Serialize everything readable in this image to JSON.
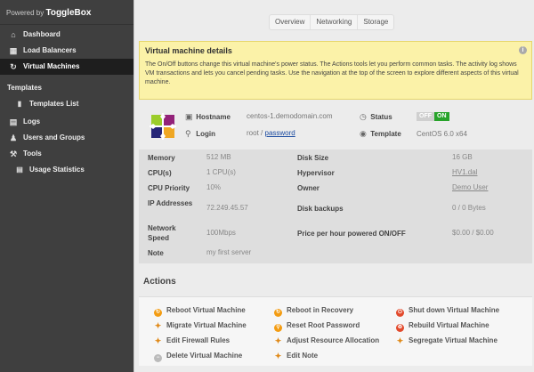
{
  "brand": {
    "prefix": "Powered by ",
    "name": "ToggleBox"
  },
  "sidebar": {
    "items": [
      {
        "label": "Dashboard",
        "icon": "home-icon"
      },
      {
        "label": "Load Balancers",
        "icon": "load-balancer-icon"
      },
      {
        "label": "Virtual Machines",
        "icon": "virtual-machines-icon",
        "active": true
      }
    ],
    "templates_section": "Templates",
    "templates_list": "Templates List",
    "logs": "Logs",
    "users": "Users and Groups",
    "tools": "Tools",
    "usage": "Usage Statistics"
  },
  "tabs": [
    "Overview",
    "Networking",
    "Storage"
  ],
  "notice": {
    "title": "Virtual machine details",
    "text": "The On/Off buttons change this virtual machine's power status. The Actions tools let you perform common tasks. The activity log shows VM transactions and lets you cancel pending tasks. Use the navigation at the top of the screen to explore different aspects of this virtual machine."
  },
  "vm": {
    "hostname_label": "Hostname",
    "hostname": "centos-1.demodomain.com",
    "login_label": "Login",
    "login_user": "root",
    "login_sep": "/",
    "password_link": "password",
    "status_label": "Status",
    "status_off": "OFF",
    "status_on": "ON",
    "template_label": "Template",
    "template": "CentOS 6.0 x64"
  },
  "details": {
    "memory_label": "Memory",
    "memory": "512 MB",
    "cpus_label": "CPU(s)",
    "cpus": "1 CPU(s)",
    "priority_label": "CPU Priority",
    "priority": "10%",
    "ip_label": "IP Addresses",
    "ip": "72.249.45.57",
    "speed_label": "Network Speed",
    "speed": "100Mbps",
    "note_label": "Note",
    "note": "my first server",
    "disk_label": "Disk Size",
    "disk": "16 GB",
    "hypervisor_label": "Hypervisor",
    "hypervisor": "HV1.dal",
    "owner_label": "Owner",
    "owner": "Demo User",
    "backups_label": "Disk backups",
    "backups": "0 / 0 Bytes",
    "price_label": "Price per hour powered ON/OFF",
    "price": "$0.00 / $0.00"
  },
  "actions": {
    "title": "Actions",
    "items": [
      "Reboot Virtual Machine",
      "Reboot in Recovery",
      "Shut down Virtual Machine",
      "Migrate Virtual Machine",
      "Reset Root Password",
      "Rebuild Virtual Machine",
      "Edit Firewall Rules",
      "Adjust Resource Allocation",
      "Segregate Virtual Machine",
      "Delete Virtual Machine",
      "Edit Note"
    ]
  },
  "colors": {
    "sidebar": "#3f3f3f",
    "active": "#1e1e1e",
    "notice": "#fbf2a8",
    "on": "#27a32a",
    "link": "#1a4aa0"
  }
}
